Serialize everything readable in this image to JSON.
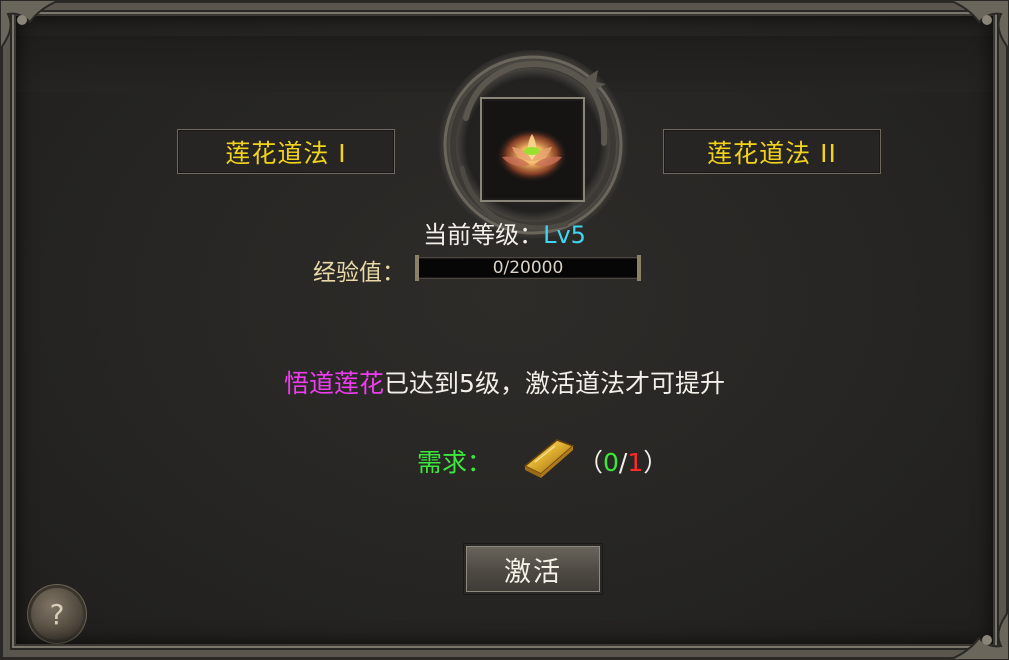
{
  "tabs": [
    {
      "label": "莲花道法 I"
    },
    {
      "label": "莲花道法 II"
    }
  ],
  "skill_icon": "lotus-icon",
  "level": {
    "label": "当前等级：",
    "value": "Lv5"
  },
  "experience": {
    "label": "经验值：",
    "current": 0,
    "max": 20000,
    "text": "0/20000",
    "fraction": 0
  },
  "notice": {
    "highlight": "悟道莲花",
    "text": "已达到5级，激活道法才可提升"
  },
  "requirement": {
    "label": "需求：",
    "item_icon": "gold-bar-icon",
    "open": "（",
    "have": "0",
    "sep": "/",
    "need": "1",
    "close": "）"
  },
  "activate_button": {
    "label": "激活"
  },
  "help_button": {
    "label": "?"
  },
  "colors": {
    "tab_text": "#f2d31b",
    "level_value": "#3fd6f2",
    "highlight": "#ee3cf0",
    "requirement": "#3ce83c",
    "need": "#ff2a2a"
  }
}
